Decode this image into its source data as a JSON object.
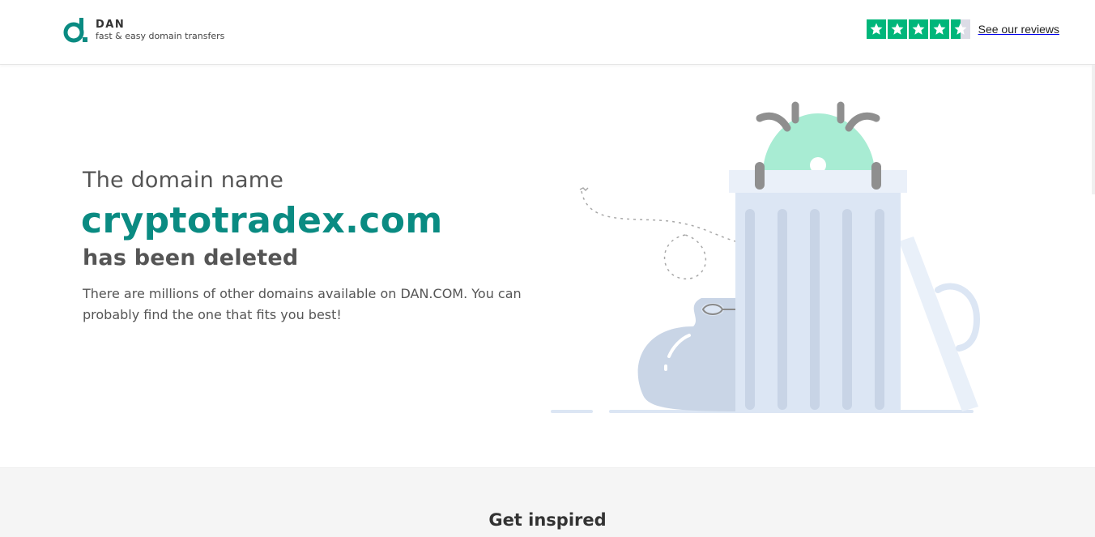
{
  "header": {
    "brand_name": "DAN",
    "brand_tagline": "fast & easy domain transfers",
    "logo_icon": "dan-logo-icon",
    "reviews": {
      "rating_stars": 4.5,
      "label": "See our reviews",
      "star_color": "#00b67a"
    }
  },
  "hero": {
    "line1": "The domain name",
    "domain": "cryptotradex.com",
    "line3": "has been deleted",
    "description": "There are millions of other domains available on DAN.COM. You can probably find the one that fits you best!",
    "accent_color": "#0a8b82",
    "illustration_icon": "trash-can-illustration"
  },
  "inspired": {
    "title": "Get inspired"
  }
}
